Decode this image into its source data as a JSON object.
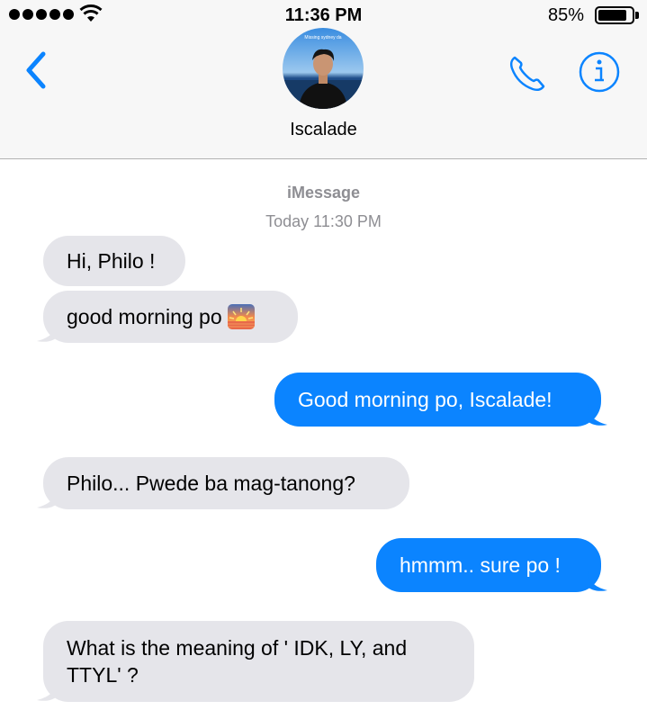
{
  "status_bar": {
    "time": "11:36 PM",
    "battery_percent": "85%",
    "battery_level": 0.85,
    "signal_bars": 5
  },
  "nav": {
    "back_icon": "chevron-left-icon",
    "contact_name": "Iscalade",
    "avatar_caption": "Missing sydney da",
    "call_icon": "phone-icon",
    "info_icon": "info-icon"
  },
  "thread": {
    "service": "iMessage",
    "timestamp": "Today 11:30 PM",
    "messages": [
      {
        "direction": "received",
        "text": "Hi, Philo !"
      },
      {
        "direction": "received",
        "text": "good morning po",
        "emoji": "sunrise"
      },
      {
        "direction": "sent",
        "text": "Good morning po, Iscalade!"
      },
      {
        "direction": "received",
        "text": "Philo... Pwede ba mag-tanong?"
      },
      {
        "direction": "sent",
        "text": "hmmm.. sure po !"
      },
      {
        "direction": "received",
        "text": "What is the meaning of ' IDK, LY,  and\nTTYL' ?"
      }
    ]
  },
  "colors": {
    "accent": "#0b84ff",
    "received_bubble": "#e5e5ea",
    "header_bg": "#f7f7f7",
    "meta_text": "#8e8e93"
  }
}
